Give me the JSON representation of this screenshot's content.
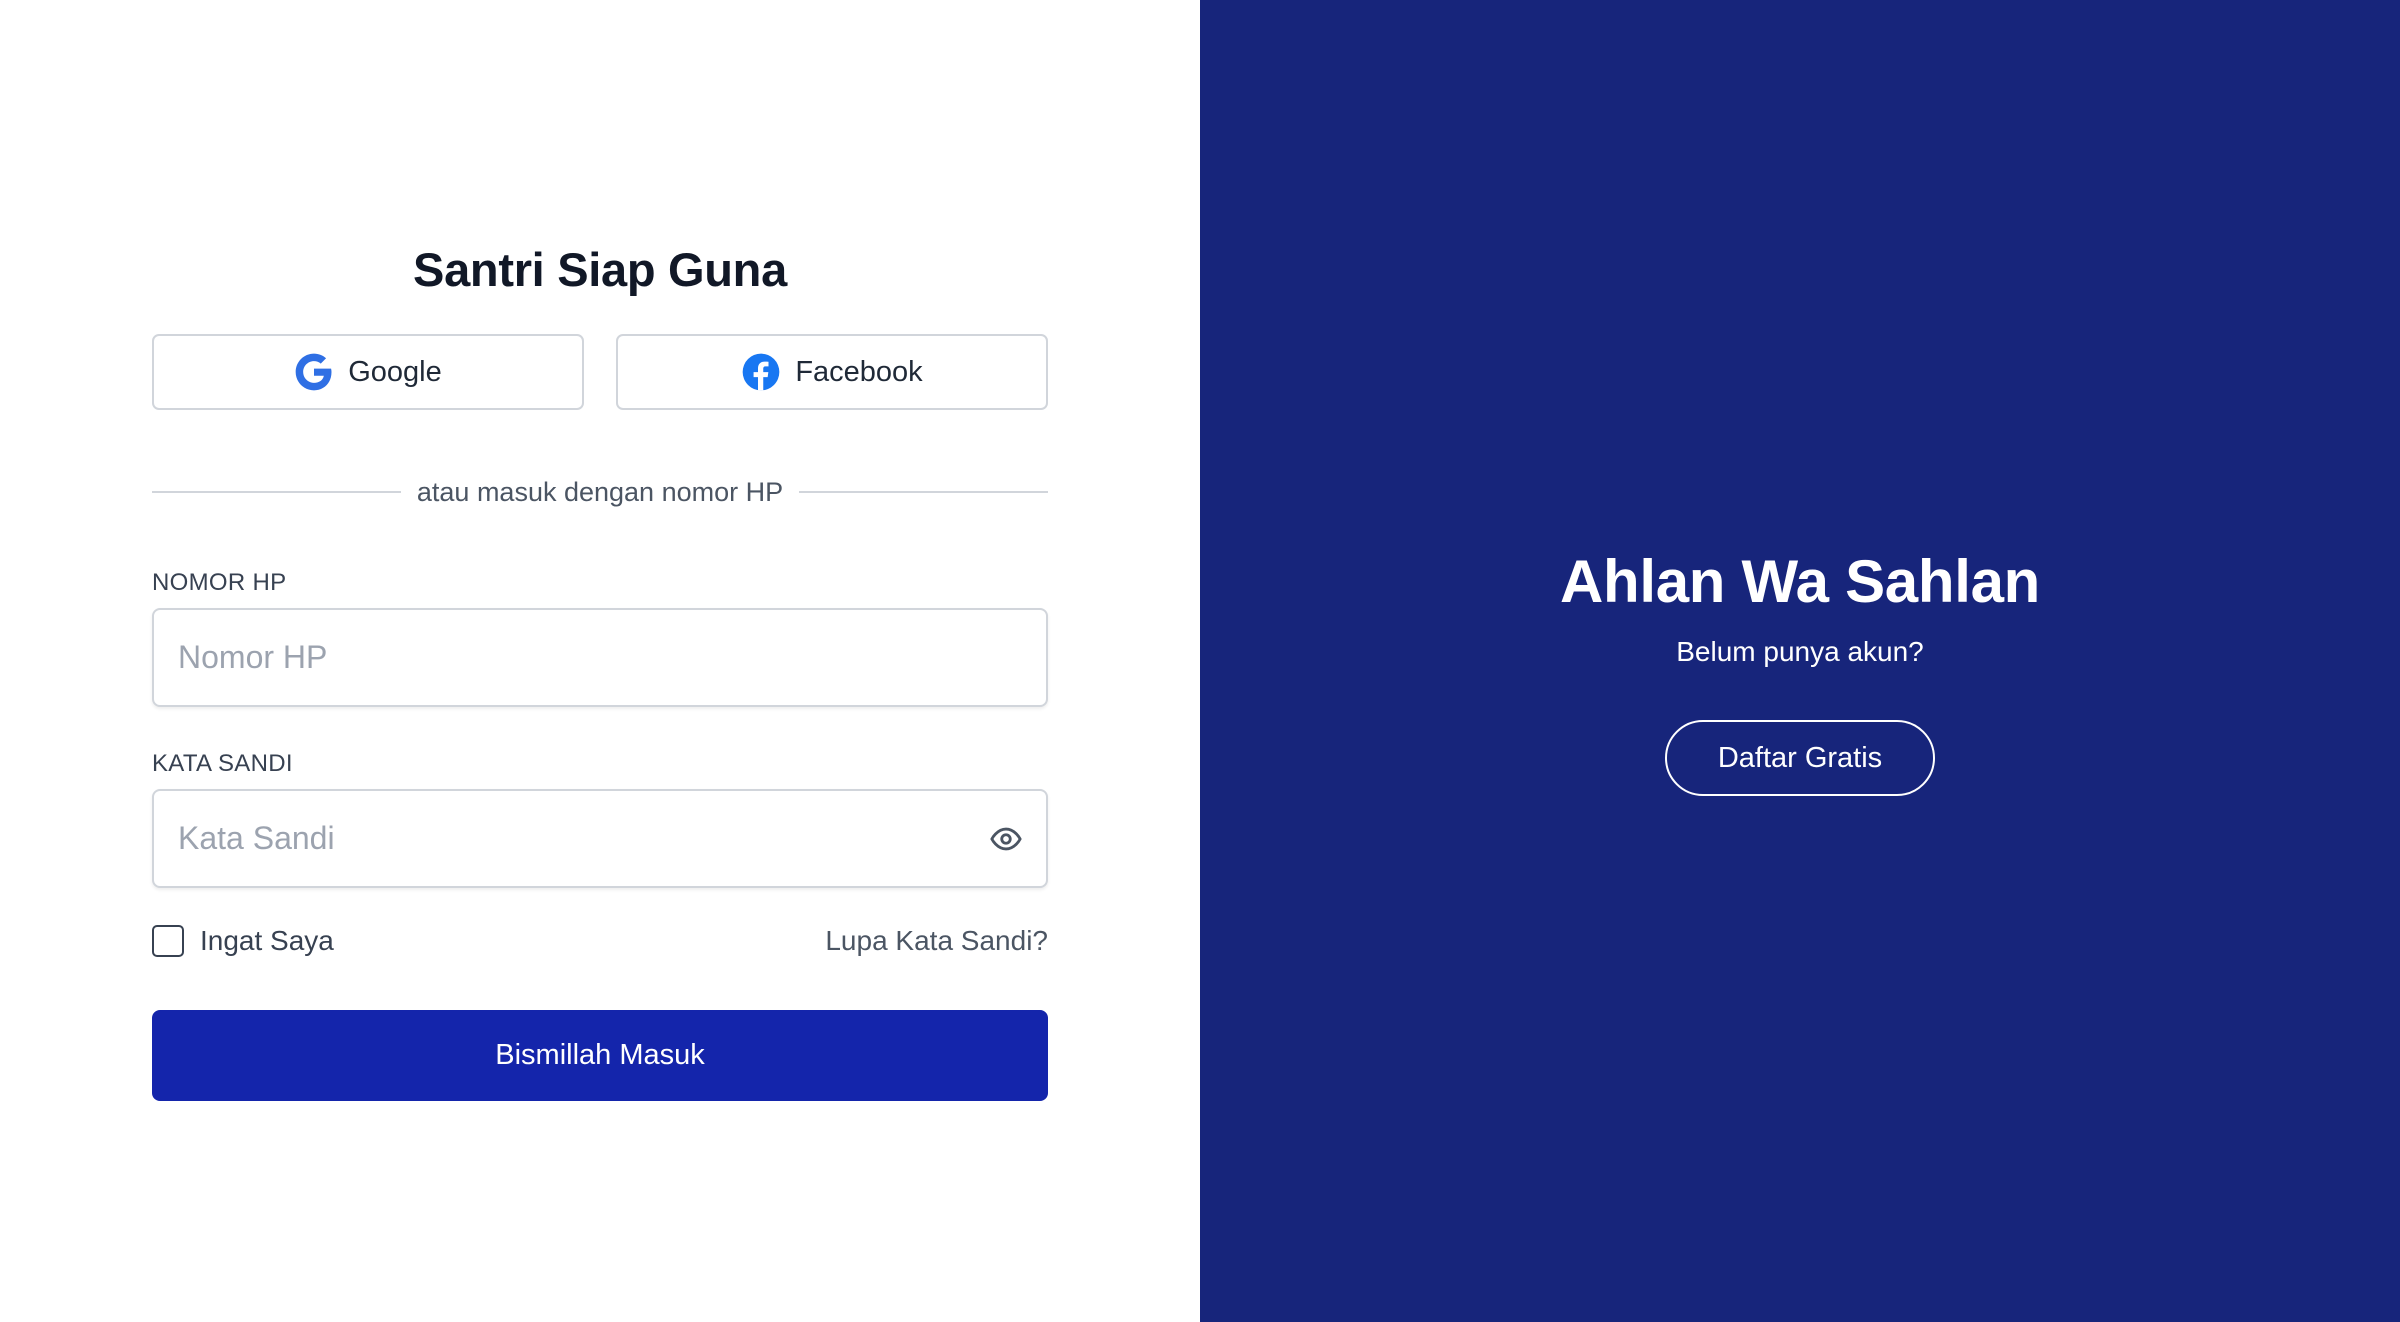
{
  "login": {
    "title": "Santri Siap Guna",
    "social": {
      "google_label": "Google",
      "facebook_label": "Facebook",
      "google_icon": "google-icon",
      "facebook_icon": "facebook-icon"
    },
    "divider_text": "atau masuk dengan nomor HP",
    "phone": {
      "label": "NOMOR HP",
      "placeholder": "Nomor HP",
      "value": ""
    },
    "password": {
      "label": "KATA SANDI",
      "placeholder": "Kata Sandi",
      "value": "",
      "toggle_icon": "eye-icon"
    },
    "remember_label": "Ingat Saya",
    "remember_checked": false,
    "forgot_label": "Lupa Kata Sandi?",
    "submit_label": "Bismillah Masuk"
  },
  "welcome": {
    "title": "Ahlan Wa Sahlan",
    "subtitle": "Belum punya akun?",
    "register_label": "Daftar Gratis"
  },
  "colors": {
    "primary_button": "#1425ab",
    "right_panel_bg": "#17257b",
    "text_dark": "#111827",
    "border": "#d1d5db",
    "google_blue": "#4285f4",
    "facebook_blue": "#1877f2"
  }
}
